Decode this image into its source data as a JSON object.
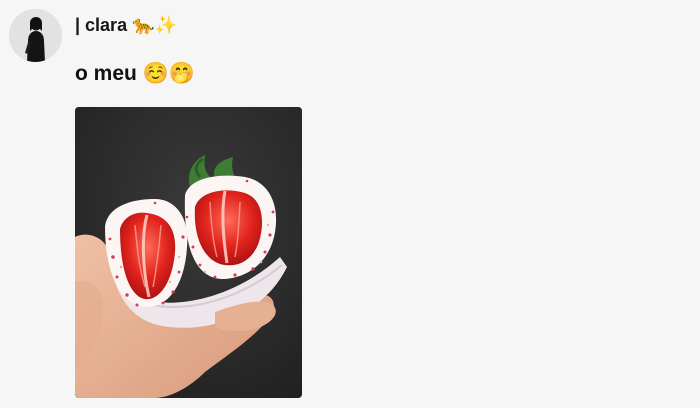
{
  "post": {
    "username": "| clara",
    "username_emoji": "🐆✨",
    "caption_text": "o meu ",
    "caption_emoji": "☺️🤭"
  },
  "icons": {
    "avatar": "user-avatar-photo",
    "photo": "strawberry-dessert-photo"
  }
}
